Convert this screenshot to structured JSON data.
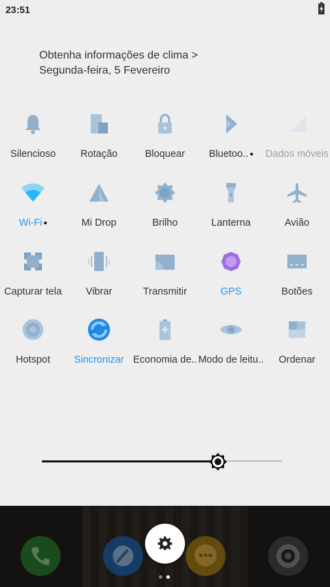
{
  "status": {
    "time": "23:51"
  },
  "header": {
    "weather_link": "Obtenha informações de clima >",
    "date": "Segunda-feira, 5 Fevereiro"
  },
  "tiles": [
    {
      "label": "Silencioso",
      "icon": "bell-icon",
      "state": "normal"
    },
    {
      "label": "Rotação",
      "icon": "rotation-icon",
      "state": "normal"
    },
    {
      "label": "Bloquear",
      "icon": "lock-icon",
      "state": "normal"
    },
    {
      "label": "Bluetoo..",
      "icon": "bluetooth-icon",
      "state": "normal",
      "dot": true
    },
    {
      "label": "Dados móveis",
      "icon": "mobile-data-icon",
      "state": "disabled"
    },
    {
      "label": "Wi-Fi",
      "icon": "wifi-icon",
      "state": "active",
      "dot": true
    },
    {
      "label": "Mi Drop",
      "icon": "mi-drop-icon",
      "state": "normal"
    },
    {
      "label": "Brilho",
      "icon": "brightness-icon",
      "state": "normal"
    },
    {
      "label": "Lanterna",
      "icon": "flashlight-icon",
      "state": "normal"
    },
    {
      "label": "Avião",
      "icon": "airplane-icon",
      "state": "normal"
    },
    {
      "label": "Capturar tela",
      "icon": "screenshot-icon",
      "state": "normal"
    },
    {
      "label": "Vibrar",
      "icon": "vibrate-icon",
      "state": "normal"
    },
    {
      "label": "Transmitir",
      "icon": "cast-icon",
      "state": "normal"
    },
    {
      "label": "GPS",
      "icon": "gps-icon",
      "state": "active"
    },
    {
      "label": "Botões",
      "icon": "buttons-icon",
      "state": "normal"
    },
    {
      "label": "Hotspot",
      "icon": "hotspot-icon",
      "state": "normal"
    },
    {
      "label": "Sincronizar",
      "icon": "sync-icon",
      "state": "active"
    },
    {
      "label": "Economia de..",
      "icon": "battery-saver-icon",
      "state": "normal"
    },
    {
      "label": "Modo de leitu..",
      "icon": "reading-mode-icon",
      "state": "normal"
    },
    {
      "label": "Ordenar",
      "icon": "sort-icon",
      "state": "normal"
    }
  ],
  "brightness": {
    "level_fraction": 0.73
  },
  "colors": {
    "icon_inactive": "#90b0cc",
    "icon_active": "#2196f3",
    "gps_active": "#9c6ee0",
    "label_text": "#333333",
    "label_active": "#2196f3",
    "label_disabled": "#9e9e9e"
  },
  "dock": {
    "apps": [
      {
        "icon": "phone-app-icon"
      },
      {
        "icon": "browser-app-icon"
      },
      {
        "icon": "messages-app-icon"
      },
      {
        "icon": "camera-app-icon"
      }
    ],
    "settings_icon": "gear-icon"
  }
}
